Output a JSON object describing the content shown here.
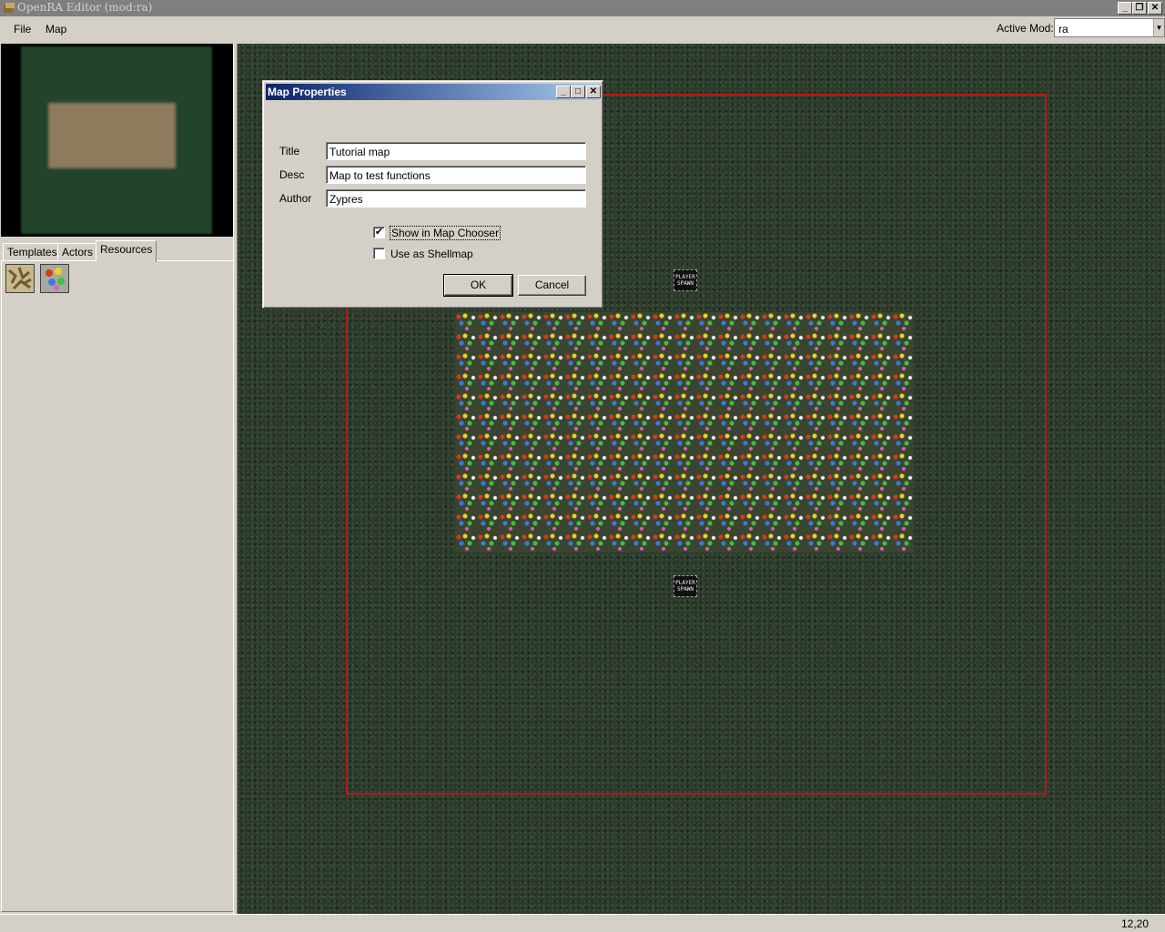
{
  "window": {
    "title": "OpenRA Editor (mod:ra)",
    "controls": [
      "minimize",
      "restore",
      "close"
    ]
  },
  "menu": {
    "items": [
      "File",
      "Map"
    ],
    "active_mod_label": "Active Mod:",
    "active_mod_value": "ra"
  },
  "left_panel": {
    "tabs": [
      "Templates",
      "Actors",
      "Resources"
    ],
    "active_tab": "Resources",
    "resource_icons": [
      "ore-resource-icon",
      "gems-resource-icon"
    ]
  },
  "map": {
    "spawns": [
      "PLAYER SPAWN",
      "PLAYER SPAWN"
    ],
    "border_color": "#b81818"
  },
  "dialog": {
    "title": "Map Properties",
    "fields": [
      {
        "label": "Title",
        "value": "Tutorial map"
      },
      {
        "label": "Desc",
        "value": "Map to test functions"
      },
      {
        "label": "Author",
        "value": "Zypres"
      }
    ],
    "checkboxes": [
      {
        "label": "Show in Map Chooser",
        "checked": true
      },
      {
        "label": "Use as Shellmap",
        "checked": false
      }
    ],
    "ok_label": "OK",
    "cancel_label": "Cancel"
  },
  "status": {
    "coords": "12,20"
  }
}
